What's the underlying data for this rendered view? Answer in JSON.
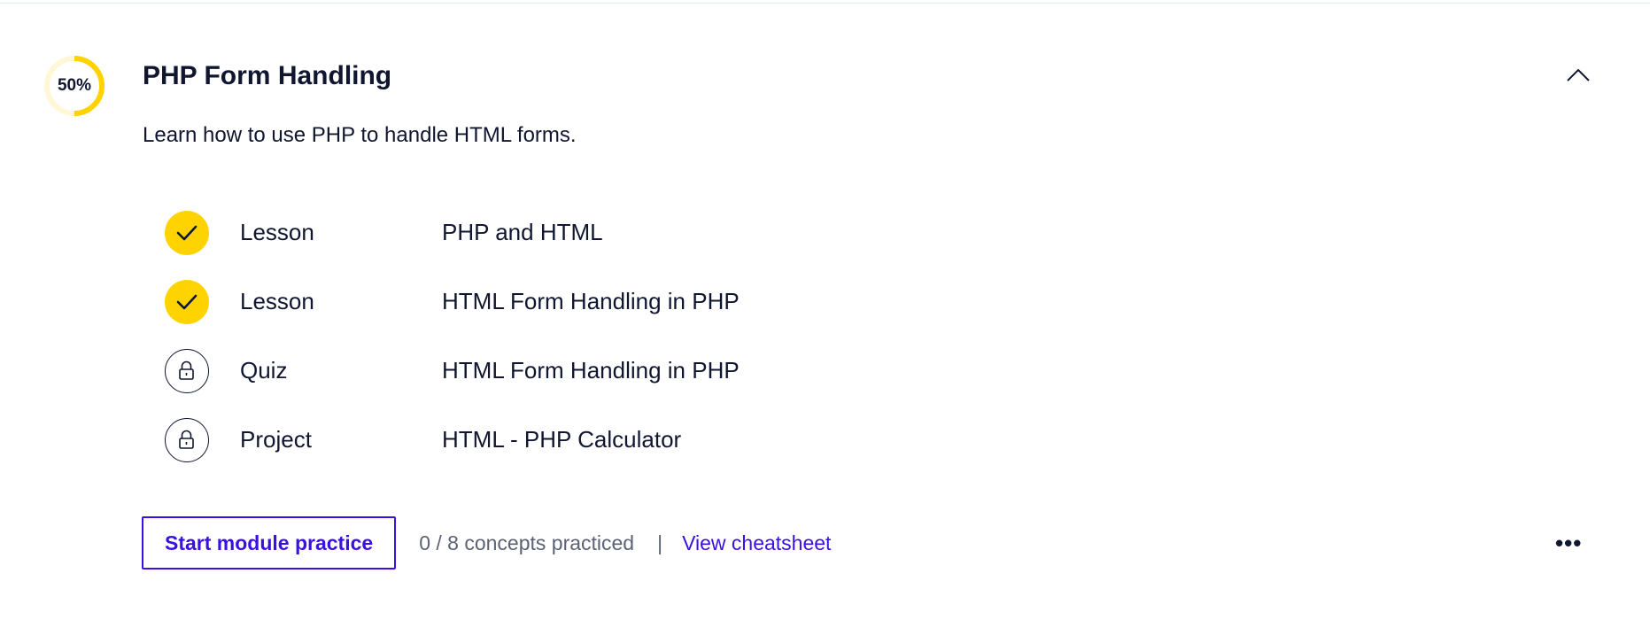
{
  "module": {
    "progress": {
      "percent_label": "50%",
      "fraction": 0.5,
      "color": "#ffd300",
      "track_color": "#fff7d6"
    },
    "title": "PHP Form Handling",
    "description": "Learn how to use PHP to handle HTML forms.",
    "collapse_icon": "chevron-up-icon",
    "items": [
      {
        "type": "Lesson",
        "title": "PHP and HTML",
        "status": "completed",
        "icon": "checkmark-icon"
      },
      {
        "type": "Lesson",
        "title": "HTML Form Handling in PHP",
        "status": "completed",
        "icon": "checkmark-icon"
      },
      {
        "type": "Quiz",
        "title": "HTML Form Handling in PHP",
        "status": "locked",
        "icon": "lock-icon"
      },
      {
        "type": "Project",
        "title": "HTML - PHP Calculator",
        "status": "locked",
        "icon": "lock-icon"
      }
    ],
    "footer": {
      "practice_button_label": "Start module practice",
      "practice_count": "0 / 8 concepts practiced",
      "divider": "|",
      "cheatsheet_link": "View cheatsheet",
      "more_label": "•••",
      "more_icon": "more-options-icon"
    }
  },
  "colors": {
    "accent": "#3a10e5",
    "completed": "#ffd300",
    "text": "#10162f",
    "muted": "#5c6274"
  }
}
